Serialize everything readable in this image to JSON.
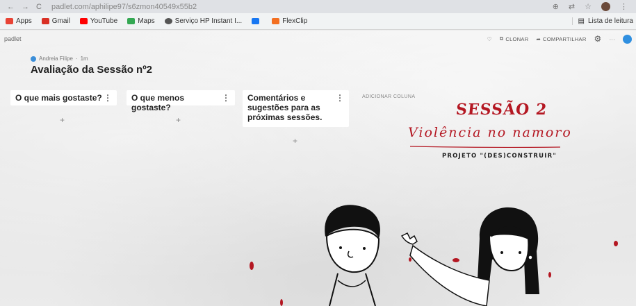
{
  "browser": {
    "url": "padlet.com/aphilipe97/s6zmon40549x55b2",
    "bookmarks": [
      {
        "label": "Apps",
        "color": "#e84335"
      },
      {
        "label": "Gmail",
        "color": "#d93025"
      },
      {
        "label": "YouTube",
        "color": "#ff0000"
      },
      {
        "label": "Maps",
        "color": "#34a853"
      },
      {
        "label": "Serviço HP Instant I...",
        "color": "#555555"
      },
      {
        "label": "",
        "color": "#1877f2"
      },
      {
        "label": "FlexClip",
        "color": "#f36f21"
      }
    ],
    "reading_list": "Lista de leitura"
  },
  "padlet": {
    "logo": "padlet",
    "actions": {
      "clone": "CLONAR",
      "share": "COMPARTILHAR"
    },
    "author": "Andreia Filipe",
    "time": "1m",
    "title": "Avaliação da Sessão nº2",
    "columns": [
      {
        "title": "O que mais gostaste?"
      },
      {
        "title": "O que menos gostaste?"
      },
      {
        "title": "Comentários e sugestões para as próximas sessões."
      }
    ],
    "add_column": "ADICIONAR COLUNA",
    "plus": "+",
    "kebab": "⋮"
  },
  "poster": {
    "session": "SESSÃO 2",
    "subtitle": "Violência no namoro",
    "project": "PROJETO \"(DES)CONSTRUIR\"",
    "accent": "#b41722"
  }
}
